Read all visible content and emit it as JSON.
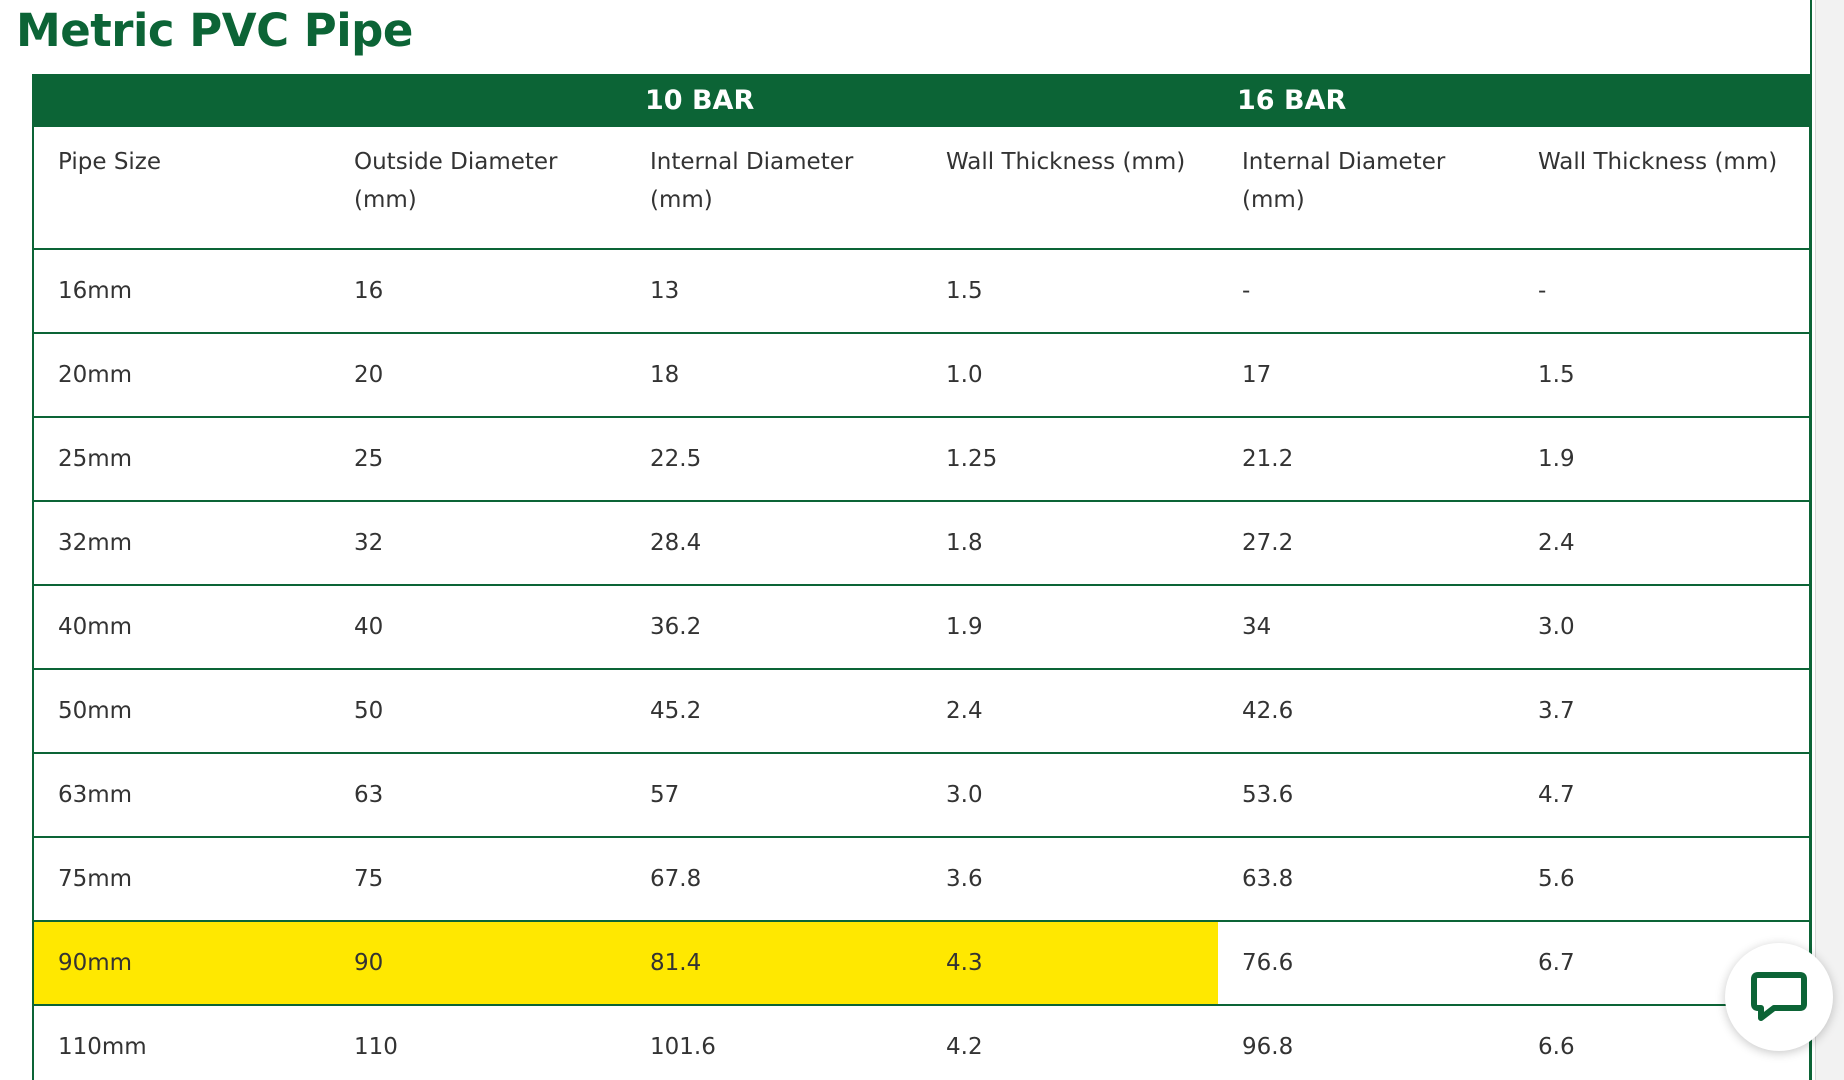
{
  "page": {
    "title": "Metric PVC Pipe"
  },
  "table": {
    "group_headers": [
      "10 BAR",
      "16 BAR"
    ],
    "columns": [
      [
        "Pipe Size",
        ""
      ],
      [
        "Outside Diameter",
        "(mm)"
      ],
      [
        "Internal Diameter",
        "(mm)"
      ],
      [
        "Wall Thickness (mm)",
        ""
      ],
      [
        "Internal Diameter",
        "(mm)"
      ],
      [
        "Wall Thickness (mm)",
        ""
      ]
    ],
    "rows": [
      [
        "16mm",
        "16",
        "13",
        "1.5",
        "-",
        "-"
      ],
      [
        "20mm",
        "20",
        "18",
        "1.0",
        "17",
        "1.5"
      ],
      [
        "25mm",
        "25",
        "22.5",
        "1.25",
        "21.2",
        "1.9"
      ],
      [
        "32mm",
        "32",
        "28.4",
        "1.8",
        "27.2",
        "2.4"
      ],
      [
        "40mm",
        "40",
        "36.2",
        "1.9",
        "34",
        "3.0"
      ],
      [
        "50mm",
        "50",
        "45.2",
        "2.4",
        "42.6",
        "3.7"
      ],
      [
        "63mm",
        "63",
        "57",
        "3.0",
        "53.6",
        "4.7"
      ],
      [
        "75mm",
        "75",
        "67.8",
        "3.6",
        "63.8",
        "5.6"
      ],
      [
        "90mm",
        "90",
        "81.4",
        "4.3",
        "76.6",
        "6.7"
      ],
      [
        "110mm",
        "110",
        "101.6",
        "4.2",
        "96.8",
        "6.6"
      ]
    ],
    "highlighted_row": 8,
    "highlighted_columns": [
      0,
      1,
      2,
      3
    ]
  },
  "chat_widget": {
    "icon": "chat-bubble-icon"
  },
  "colors": {
    "brand_green": "#0c6436",
    "highlight_yellow": "#ffe800",
    "text": "#333333"
  }
}
